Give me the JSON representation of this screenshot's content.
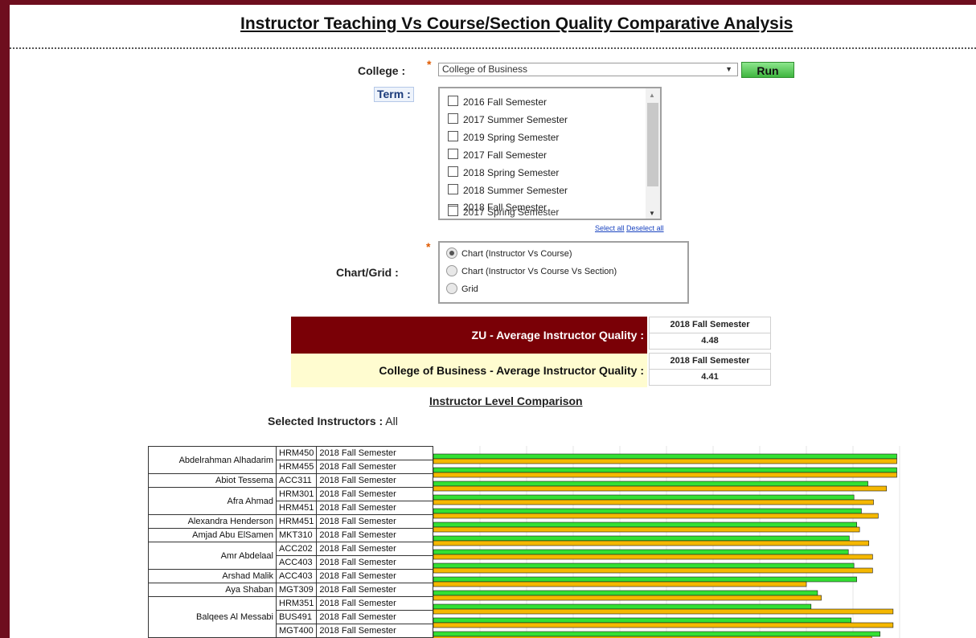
{
  "page": {
    "title": "Instructor Teaching Vs Course/Section Quality Comparative Analysis"
  },
  "form": {
    "college_label": "College :",
    "college_value": "College of Business",
    "run_label": "Run",
    "term_label": "Term :",
    "terms": [
      {
        "label": "2016 Fall Semester",
        "checked": false
      },
      {
        "label": "2017 Summer Semester",
        "checked": false
      },
      {
        "label": "2019 Spring Semester",
        "checked": false
      },
      {
        "label": "2017 Fall Semester",
        "checked": false
      },
      {
        "label": "2018 Spring Semester",
        "checked": false
      },
      {
        "label": "2018 Summer Semester",
        "checked": false
      },
      {
        "label": "2018 Fall Semester",
        "checked": true
      }
    ],
    "select_all": "Select all",
    "deselect_all": "Deselect all",
    "chart_grid_label": "Chart/Grid :",
    "chart_options": [
      {
        "label": "Chart (Instructor Vs Course)",
        "selected": true
      },
      {
        "label": "Chart (Instructor Vs Course Vs Section)",
        "selected": false
      },
      {
        "label": "Grid",
        "selected": false
      }
    ]
  },
  "averages": {
    "zu_label": "ZU - Average Instructor Quality :",
    "zu_term": "2018 Fall Semester",
    "zu_value": "4.48",
    "college_label": "College of Business - Average Instructor Quality :",
    "college_term": "2018 Fall Semester",
    "college_value": "4.41"
  },
  "comparison": {
    "title": "Instructor Level Comparison",
    "selected_label": "Selected Instructors :",
    "selected_value": "All"
  },
  "colors": {
    "green_bar": "#33e033",
    "orange_bar": "#f5b800",
    "brand_dark": "#7a0006"
  },
  "chart_data": {
    "type": "bar",
    "orientation": "horizontal",
    "series": [
      {
        "values": [
          4.97,
          4.97,
          4.66,
          4.51,
          4.59,
          4.54,
          4.46,
          4.45,
          4.51,
          4.54,
          4.12,
          4.05,
          4.48,
          4.79,
          4.49
        ]
      },
      {
        "values": [
          4.97,
          4.97,
          4.86,
          4.72,
          4.77,
          4.57,
          4.67,
          4.71,
          4.71,
          4.0,
          4.16,
          4.93,
          4.93,
          4.7,
          4.81
        ]
      }
    ],
    "rows": [
      {
        "instructor": "Abdelrahman Alhadarim",
        "course": "HRM450",
        "term": "2018 Fall Semester"
      },
      {
        "instructor": "",
        "course": "HRM455",
        "term": "2018 Fall Semester"
      },
      {
        "instructor": "Abiot Tessema",
        "course": "ACC311",
        "term": "2018 Fall Semester"
      },
      {
        "instructor": "Afra Ahmad",
        "course": "HRM301",
        "term": "2018 Fall Semester"
      },
      {
        "instructor": "",
        "course": "HRM451",
        "term": "2018 Fall Semester"
      },
      {
        "instructor": "Alexandra Henderson",
        "course": "HRM451",
        "term": "2018 Fall Semester"
      },
      {
        "instructor": "Amjad Abu ElSamen",
        "course": "MKT310",
        "term": "2018 Fall Semester"
      },
      {
        "instructor": "Amr Abdelaal",
        "course": "ACC202",
        "term": "2018 Fall Semester"
      },
      {
        "instructor": "",
        "course": "ACC403",
        "term": "2018 Fall Semester"
      },
      {
        "instructor": "Arshad Malik",
        "course": "ACC403",
        "term": "2018 Fall Semester"
      },
      {
        "instructor": "Aya Shaban",
        "course": "MGT309",
        "term": "2018 Fall Semester"
      },
      {
        "instructor": "Balqees Al Messabi",
        "course": "HRM351",
        "term": "2018 Fall Semester"
      },
      {
        "instructor": "",
        "course": "BUS491",
        "term": "2018 Fall Semester"
      },
      {
        "instructor": "",
        "course": "MGT400",
        "term": "2018 Fall Semester"
      }
    ]
  }
}
